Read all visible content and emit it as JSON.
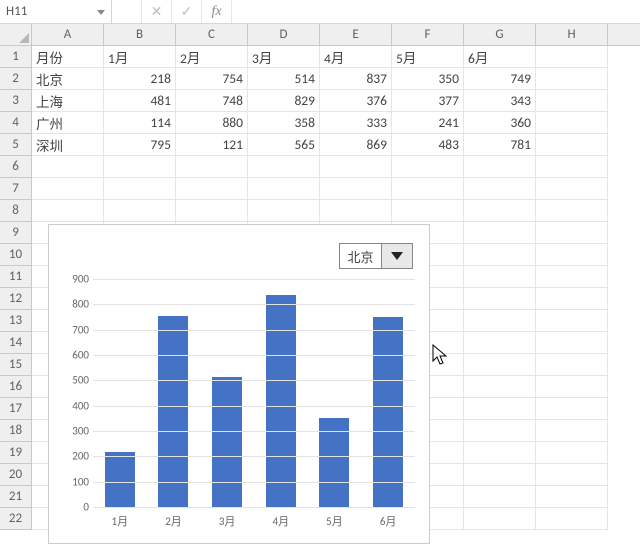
{
  "namebox": "H11",
  "formula": "",
  "columns": [
    "A",
    "B",
    "C",
    "D",
    "E",
    "F",
    "G",
    "H"
  ],
  "row_numbers": [
    1,
    2,
    3,
    4,
    5,
    6,
    7,
    8,
    9,
    10,
    11,
    12,
    13,
    14,
    15,
    16,
    17,
    18,
    19,
    20,
    21,
    22
  ],
  "table": {
    "headers": [
      "月份",
      "1月",
      "2月",
      "3月",
      "4月",
      "5月",
      "6月"
    ],
    "rows": [
      {
        "label": "北京",
        "vals": [
          218,
          754,
          514,
          837,
          350,
          749
        ]
      },
      {
        "label": "上海",
        "vals": [
          481,
          748,
          829,
          376,
          377,
          343
        ]
      },
      {
        "label": "广州",
        "vals": [
          114,
          880,
          358,
          333,
          241,
          360
        ]
      },
      {
        "label": "深圳",
        "vals": [
          795,
          121,
          565,
          869,
          483,
          781
        ]
      }
    ]
  },
  "chart_dropdown_selected": "北京",
  "chart_data": {
    "type": "bar",
    "title": "",
    "categories": [
      "1月",
      "2月",
      "3月",
      "4月",
      "5月",
      "6月"
    ],
    "values": [
      218,
      754,
      514,
      837,
      350,
      749
    ],
    "series_name": "北京",
    "ylim": [
      0,
      900
    ],
    "ystep": 100,
    "xlabel": "",
    "ylabel": "",
    "bar_color": "#4472c4"
  }
}
